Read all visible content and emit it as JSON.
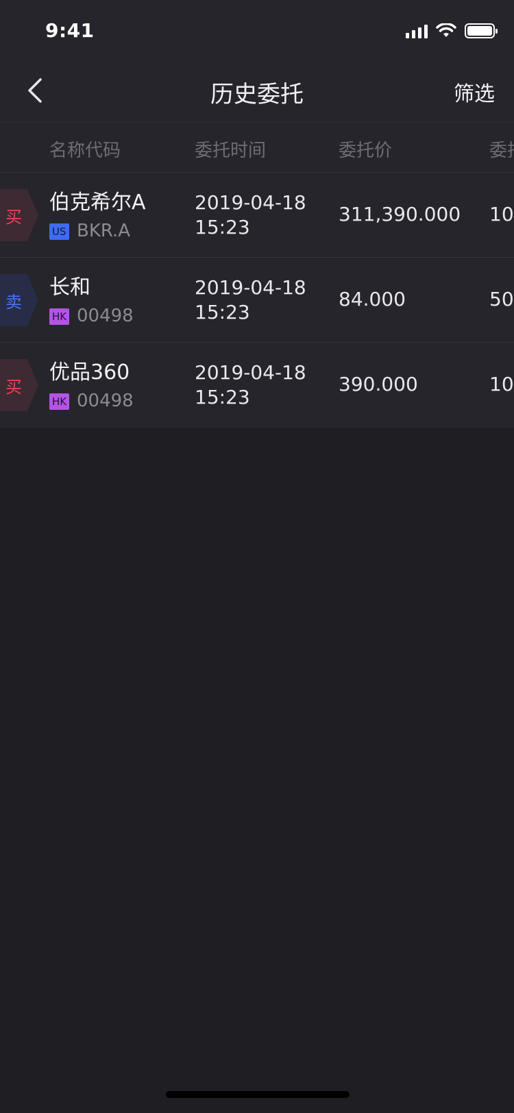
{
  "status": {
    "time": "9:41"
  },
  "nav": {
    "title": "历史委托",
    "filter_label": "筛选"
  },
  "table": {
    "headers": [
      "名称代码",
      "委托时间",
      "委托价",
      "委托"
    ],
    "rows": [
      {
        "side": "买",
        "name": "伯克希尔A",
        "market": "US",
        "code": "BKR.A",
        "date": "2019-04-18",
        "time": "15:23",
        "price": "311,390.000",
        "qty": "10"
      },
      {
        "side": "卖",
        "name": "长和",
        "market": "HK",
        "code": "00498",
        "date": "2019-04-18",
        "time": "15:23",
        "price": "84.000",
        "qty": "50"
      },
      {
        "side": "买",
        "name": "优品360",
        "market": "HK",
        "code": "00498",
        "date": "2019-04-18",
        "time": "15:23",
        "price": "390.000",
        "qty": "10"
      }
    ]
  },
  "colors": {
    "background": "#1f1e23",
    "surface": "#26252b",
    "buy": "#f0415a",
    "sell": "#4a76f5",
    "us_tag": "#3d6cf0",
    "hk_tag": "#b454e6"
  },
  "icons": {
    "back": "chevron-left-icon",
    "signal": "signal-icon",
    "wifi": "wifi-icon",
    "battery": "battery-icon"
  }
}
